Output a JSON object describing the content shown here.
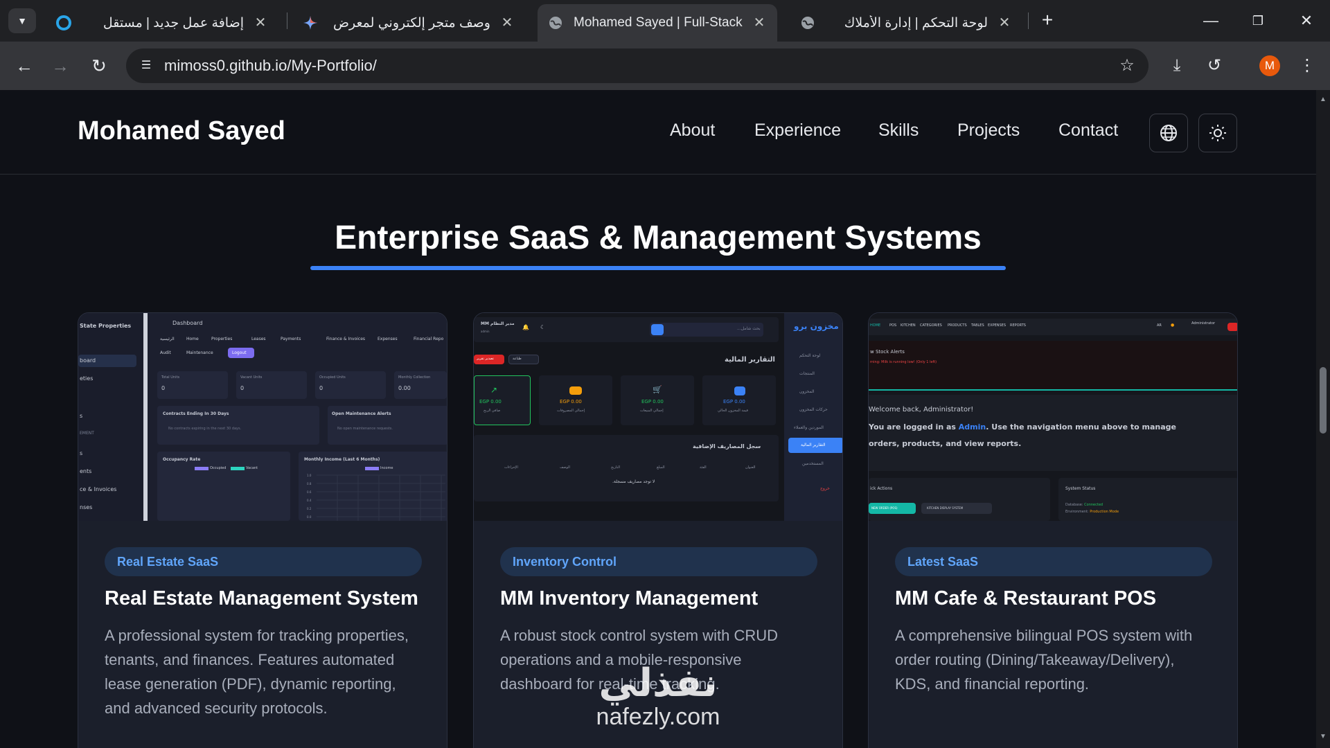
{
  "browser": {
    "tabs": [
      {
        "title": "إضافة عمل جديد | مستقل",
        "icon": "mostaql-icon",
        "active": false
      },
      {
        "title": "وصف متجر إلكتروني لمعرض الأ...",
        "icon": "gemini-icon",
        "active": false
      },
      {
        "title": "Mohamed Sayed | Full-Stack De",
        "icon": "globe-icon",
        "active": true
      },
      {
        "title": "لوحة التحكم | إدارة الأملاك",
        "icon": "globe-icon",
        "active": false
      }
    ],
    "url": "mimoss0.github.io/My-Portfolio/",
    "profile_initial": "M",
    "profile_color": "#e8590c"
  },
  "header": {
    "brand": "Mohamed Sayed",
    "nav": [
      "About",
      "Experience",
      "Skills",
      "Projects",
      "Contact"
    ]
  },
  "section": {
    "title": "Enterprise SaaS & Management Systems",
    "accent_color": "#3b82f6"
  },
  "projects": [
    {
      "badge": "Real Estate SaaS",
      "title": "Real Estate Management System",
      "description": "A professional system for tracking properties, tenants, and finances. Features automated lease generation (PDF), dynamic reporting, and advanced security protocols.",
      "preview": {
        "sidebar_title": "State Properties",
        "sidebar_items": [
          "board",
          "eties",
          "s",
          "EMENT",
          "s",
          "ents",
          "ce & Invoices",
          "nses"
        ],
        "topbar_title": "Dashboard",
        "nav": [
          "الرئيسية",
          "Home",
          "Properties",
          "Leases",
          "Payments",
          "Finance & Invoices",
          "Expenses",
          "Financial Repo",
          "Audit",
          "Maintenance",
          "Logout"
        ],
        "stats": [
          {
            "label": "Total Units",
            "value": "0"
          },
          {
            "label": "Vacant Units",
            "value": "0"
          },
          {
            "label": "Occupied Units",
            "value": "0"
          },
          {
            "label": "Monthly Collection",
            "value": "0.00"
          }
        ],
        "panel1_title": "Contracts Ending In 30 Days",
        "panel1_text": "No contracts expiring in the next 30 days.",
        "panel2_title": "Open Maintenance Alerts",
        "panel2_text": "No open maintenance requests.",
        "chart1_title": "Occupancy Rate",
        "chart1_legend": [
          "Occupied",
          "Vacant"
        ],
        "chart2_title": "Monthly Income (Last 6 Months)",
        "chart2_legend": "Income",
        "chart2_ticks": [
          "1.0",
          "0.8",
          "0.6",
          "0.4",
          "0.2",
          "0.0"
        ]
      }
    },
    {
      "badge": "Inventory Control",
      "title": "MM Inventory Management",
      "description": "A robust stock control system with CRUD operations and a mobile-responsive dashboard for real-time tracking.",
      "preview": {
        "brand": "مخزون برو",
        "header_title": "مدير النظام MM",
        "header_sub": "admin",
        "search_placeholder": "بحث شامل...",
        "btn_red": "تصدير تقرير",
        "btn_dark": "طباعة",
        "page_title": "التقارير المالية",
        "kpis": [
          {
            "value": "EGP 0.00",
            "label": "صافي الربح"
          },
          {
            "value": "EGP 0.00",
            "label": "إجمالي المصروفات"
          },
          {
            "value": "EGP 0.00",
            "label": "إجمالي المبيعات"
          },
          {
            "value": "EGP 0.00",
            "label": "قيمة المخزون الحالي"
          }
        ],
        "table_title": "سجل المصاريف الإضافية",
        "table_cols": [
          "العنوان",
          "الفئة",
          "المبلغ",
          "التاريخ",
          "الوصف",
          "الإجراءات"
        ],
        "table_empty": "لا توجد مصاريف مسجلة.",
        "side_items": [
          "لوحة التحكم",
          "المنتجات",
          "المخزون",
          "حركات المخزون",
          "الموردين والعملاء",
          "التقارير المالية",
          "المستخدمين",
          "خروج"
        ]
      }
    },
    {
      "badge": "Latest SaaS",
      "title": "MM Cafe & Restaurant POS",
      "description": "A comprehensive bilingual POS system with order routing (Dining/Takeaway/Delivery), KDS, and financial reporting.",
      "preview": {
        "nav": [
          "HOME",
          "POS",
          "KITCHEN",
          "CATEGORIES",
          "PRODUCTS",
          "TABLES",
          "EXPENSES",
          "REPORTS"
        ],
        "lang": "AR",
        "user": "Administrator",
        "alert_title": "w Stock Alerts",
        "alert_text": "rning: Milk is running low! (Only 1 left)",
        "welcome": "Welcome back, Administrator!",
        "logged_prefix": "You are logged in as ",
        "logged_role": "Admin",
        "logged_suffix": ". Use the navigation menu above to manage",
        "logged_line2": "orders, products, and view reports.",
        "quick_title": "ick Actions",
        "quick_btn1": "NEW ORDER (POS)",
        "quick_btn2": "KITCHEN DISPLAY SYSTEM",
        "status_title": "System Status",
        "status_db_label": "Database: ",
        "status_db": "Connected",
        "status_env_label": "Environment: ",
        "status_env": "Production Mode"
      }
    }
  ],
  "watermark": {
    "arabic": "نفذلي",
    "latin": "nafezly.com"
  }
}
